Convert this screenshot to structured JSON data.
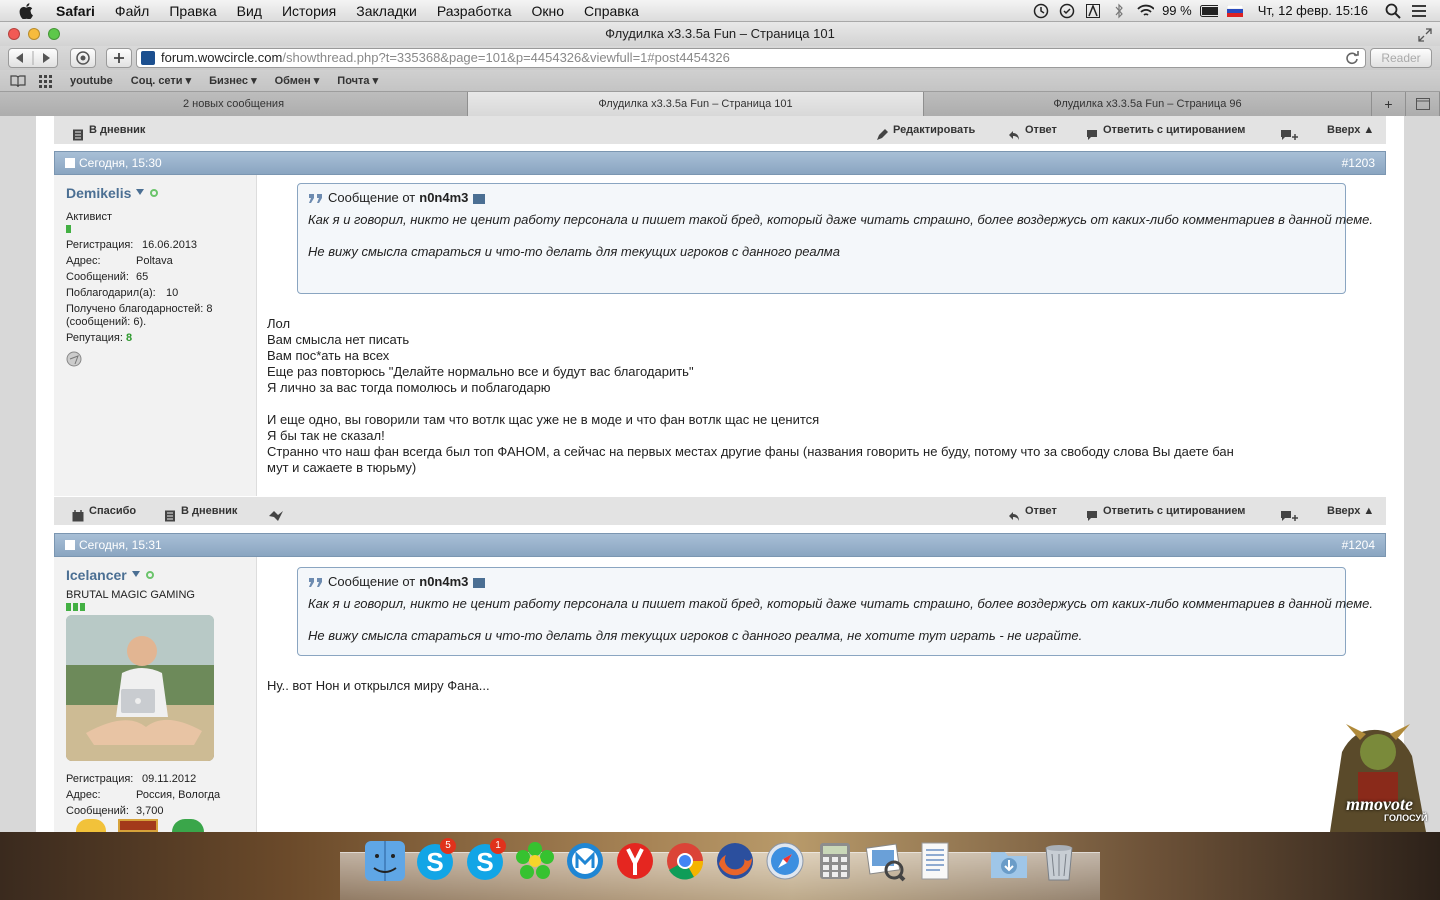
{
  "menubar": {
    "app": "Safari",
    "items": [
      "Файл",
      "Правка",
      "Вид",
      "История",
      "Закладки",
      "Разработка",
      "Окно",
      "Справка"
    ],
    "battery": "99 %",
    "datetime": "Чт, 12 февр.  15:16"
  },
  "window": {
    "title": "Флудилка x3.3.5a Fun – Страница 101",
    "url_host": "forum.wowcircle.com",
    "url_path": "/showthread.php?t=335368&page=101&p=4454326&viewfull=1#post4454326",
    "reader_label": "Reader"
  },
  "bookmarks": [
    "youtube",
    "Соц. сети ▾",
    "Бизнес ▾",
    "Обмен ▾",
    "Почта ▾"
  ],
  "tabs": [
    {
      "label": "2 новых сообщения",
      "active": false
    },
    {
      "label": "Флудилка x3.3.5a Fun – Страница 101",
      "active": true
    },
    {
      "label": "Флудилка x3.3.5a Fun – Страница 96",
      "active": false
    }
  ],
  "actions": {
    "diary": "В дневник",
    "edit": "Редактировать",
    "reply": "Ответ",
    "quote_reply": "Ответить с цитированием",
    "top": "Вверх ▲",
    "thanks": "Спасибо"
  },
  "posts": [
    {
      "date": "Сегодня, 15:30",
      "number": "#1203",
      "user": {
        "name": "Demikelis",
        "title": "Активист",
        "lines": [
          {
            "k": "Регистрация:",
            "v": "16.06.2013"
          },
          {
            "k": "Адрес:",
            "v": "Poltava"
          },
          {
            "k": "Сообщений:",
            "v": "65"
          },
          {
            "k": "Поблагодарил(а):",
            "v": "10"
          }
        ],
        "thanks_line1": "Получено благодарностей: 8",
        "thanks_line2": "(сообщений: 6).",
        "rep_label": "Репутация:",
        "rep_value": "8"
      },
      "quote": {
        "label": "Сообщение от",
        "author": "n0n4m3",
        "line1": "Как я и говорил, никто не ценит работу персонала и пишет такой бред, который даже читать страшно, более воздержусь от каких-либо комментариев в данной теме.",
        "line2": "Не вижу смысла стараться и что-то делать для текущих игроков с данного реалма"
      },
      "message": [
        "Лол",
        "Вам смысла нет писать",
        "Вам пос*ать на всех",
        "Еще раз повторюсь \"Делайте нормально все и будут вас благодарить\"",
        "Я лично за вас тогда помолюсь и поблагодарю",
        "",
        "И еще одно, вы говорили там что вотлк щас уже не в моде и что фан вотлк щас не ценится",
        "Я бы так не сказал!",
        "Странно что наш фан всегда был топ ФАНОМ, а сейчас на первых местах другие фаны (названия говорить не буду, потому что за свободу слова Вы даете бан",
        "мут и сажаете в тюрьму)"
      ]
    },
    {
      "date": "Сегодня, 15:31",
      "number": "#1204",
      "user": {
        "name": "Icelancer",
        "title": "BRUTAL MAGIC GAMING",
        "lines": [
          {
            "k": "Регистрация:",
            "v": "09.11.2012"
          },
          {
            "k": "Адрес:",
            "v": "Россия, Вологда"
          },
          {
            "k": "Сообщений:",
            "v": "3,700"
          }
        ]
      },
      "quote": {
        "label": "Сообщение от",
        "author": "n0n4m3",
        "line1": "Как я и говорил, никто не ценит работу персонала и пишет такой бред, который даже читать страшно, более воздержусь от каких-либо комментариев в данной теме.",
        "line2": "Не вижу смысла стараться и что-то делать для текущих игроков с данного реалма, не хотите тут играть - не играйте."
      },
      "message": [
        "Ну.. вот Нон и открылся миру Фана..."
      ]
    }
  ],
  "banner": {
    "brand": "mmovote",
    "sub": "ГОЛОСУЙ"
  },
  "dock": {
    "badges": [
      "5",
      "1"
    ]
  },
  "colors": {
    "post_header": "#8aa5c1",
    "username": "#4b6f93",
    "reputation": "#2e9a2e"
  }
}
